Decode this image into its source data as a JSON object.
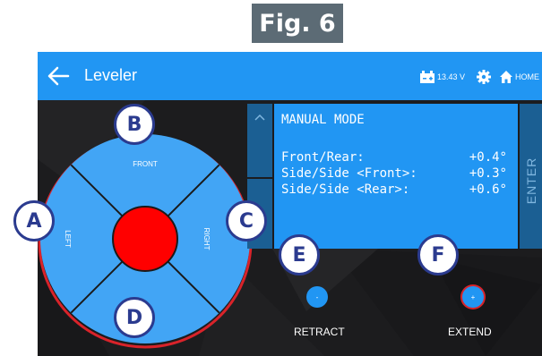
{
  "figure": {
    "caption": "Fig. 6"
  },
  "header": {
    "title": "Leveler",
    "battery_voltage": "13.43 V",
    "home_label": "HOME",
    "back_icon": "arrow-left-icon",
    "battery_icon": "battery-icon",
    "settings_icon": "gear-icon",
    "home_icon": "home-icon"
  },
  "pad": {
    "front_label": "FRONT",
    "left_label": "LEFT",
    "right_label": "RIGHT",
    "center_color": "#ff0000",
    "pad_color": "#42a5f5"
  },
  "panel": {
    "mode": "MANUAL MODE",
    "readings": [
      {
        "label": "Front/Rear:",
        "value": "+0.4°"
      },
      {
        "label": "Side/Side <Front>:",
        "value": "+0.3°"
      },
      {
        "label": "Side/Side <Rear>:",
        "value": "+0.6°"
      }
    ],
    "up_icon": "chevron-up-icon",
    "enter_label": "ENTER"
  },
  "controls": {
    "retract_label": "RETRACT",
    "retract_symbol": "-",
    "extend_label": "EXTEND",
    "extend_symbol": "+"
  },
  "callouts": {
    "a": "A",
    "b": "B",
    "c": "C",
    "d": "D",
    "e": "E",
    "f": "F"
  },
  "colors": {
    "accent": "#2196f3",
    "dark_button": "#1b5f93",
    "background": "#1c1c1e",
    "callout_border": "#2b3b8f",
    "caption_bg": "#5c6b75",
    "alert_red": "#d9232a"
  }
}
